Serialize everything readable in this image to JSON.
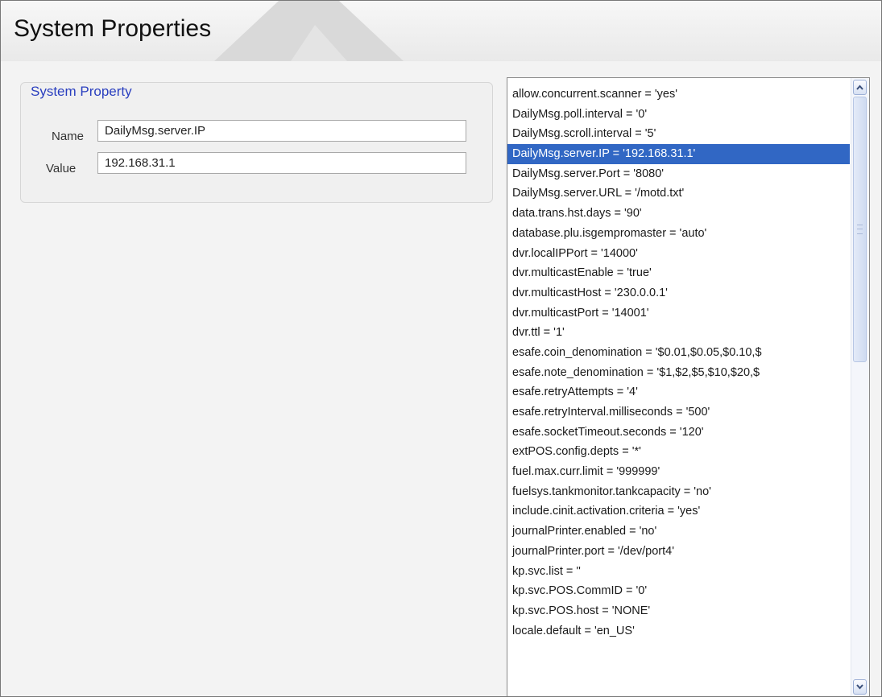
{
  "header": {
    "title": "System Properties"
  },
  "group": {
    "legend": "System Property",
    "name_label": "Name",
    "name_value": "DailyMsg.server.IP",
    "value_label": "Value",
    "value_value": "192.168.31.1"
  },
  "list": {
    "selected_index": 3,
    "items": [
      "allow.concurrent.scanner = 'yes'",
      "DailyMsg.poll.interval = '0'",
      "DailyMsg.scroll.interval = '5'",
      "DailyMsg.server.IP = '192.168.31.1'",
      "DailyMsg.server.Port = '8080'",
      "DailyMsg.server.URL = '/motd.txt'",
      "data.trans.hst.days = '90'",
      "database.plu.isgempromaster = 'auto'",
      "dvr.localIPPort = '14000'",
      "dvr.multicastEnable = 'true'",
      "dvr.multicastHost = '230.0.0.1'",
      "dvr.multicastPort = '14001'",
      "dvr.ttl = '1'",
      "esafe.coin_denomination = '$0.01,$0.05,$0.10,$",
      "esafe.note_denomination = '$1,$2,$5,$10,$20,$",
      "esafe.retryAttempts = '4'",
      "esafe.retryInterval.milliseconds = '500'",
      "esafe.socketTimeout.seconds = '120'",
      "extPOS.config.depts = '*'",
      "fuel.max.curr.limit = '999999'",
      "fuelsys.tankmonitor.tankcapacity = 'no'",
      "include.cinit.activation.criteria = 'yes'",
      "journalPrinter.enabled = 'no'",
      "journalPrinter.port = '/dev/port4'",
      "kp.svc.list = ''",
      "kp.svc.POS.CommID = '0'",
      "kp.svc.POS.host = 'NONE'",
      "locale.default = 'en_US'"
    ]
  },
  "colors": {
    "selection": "#3167c4",
    "legend_text": "#2a3fbf"
  }
}
